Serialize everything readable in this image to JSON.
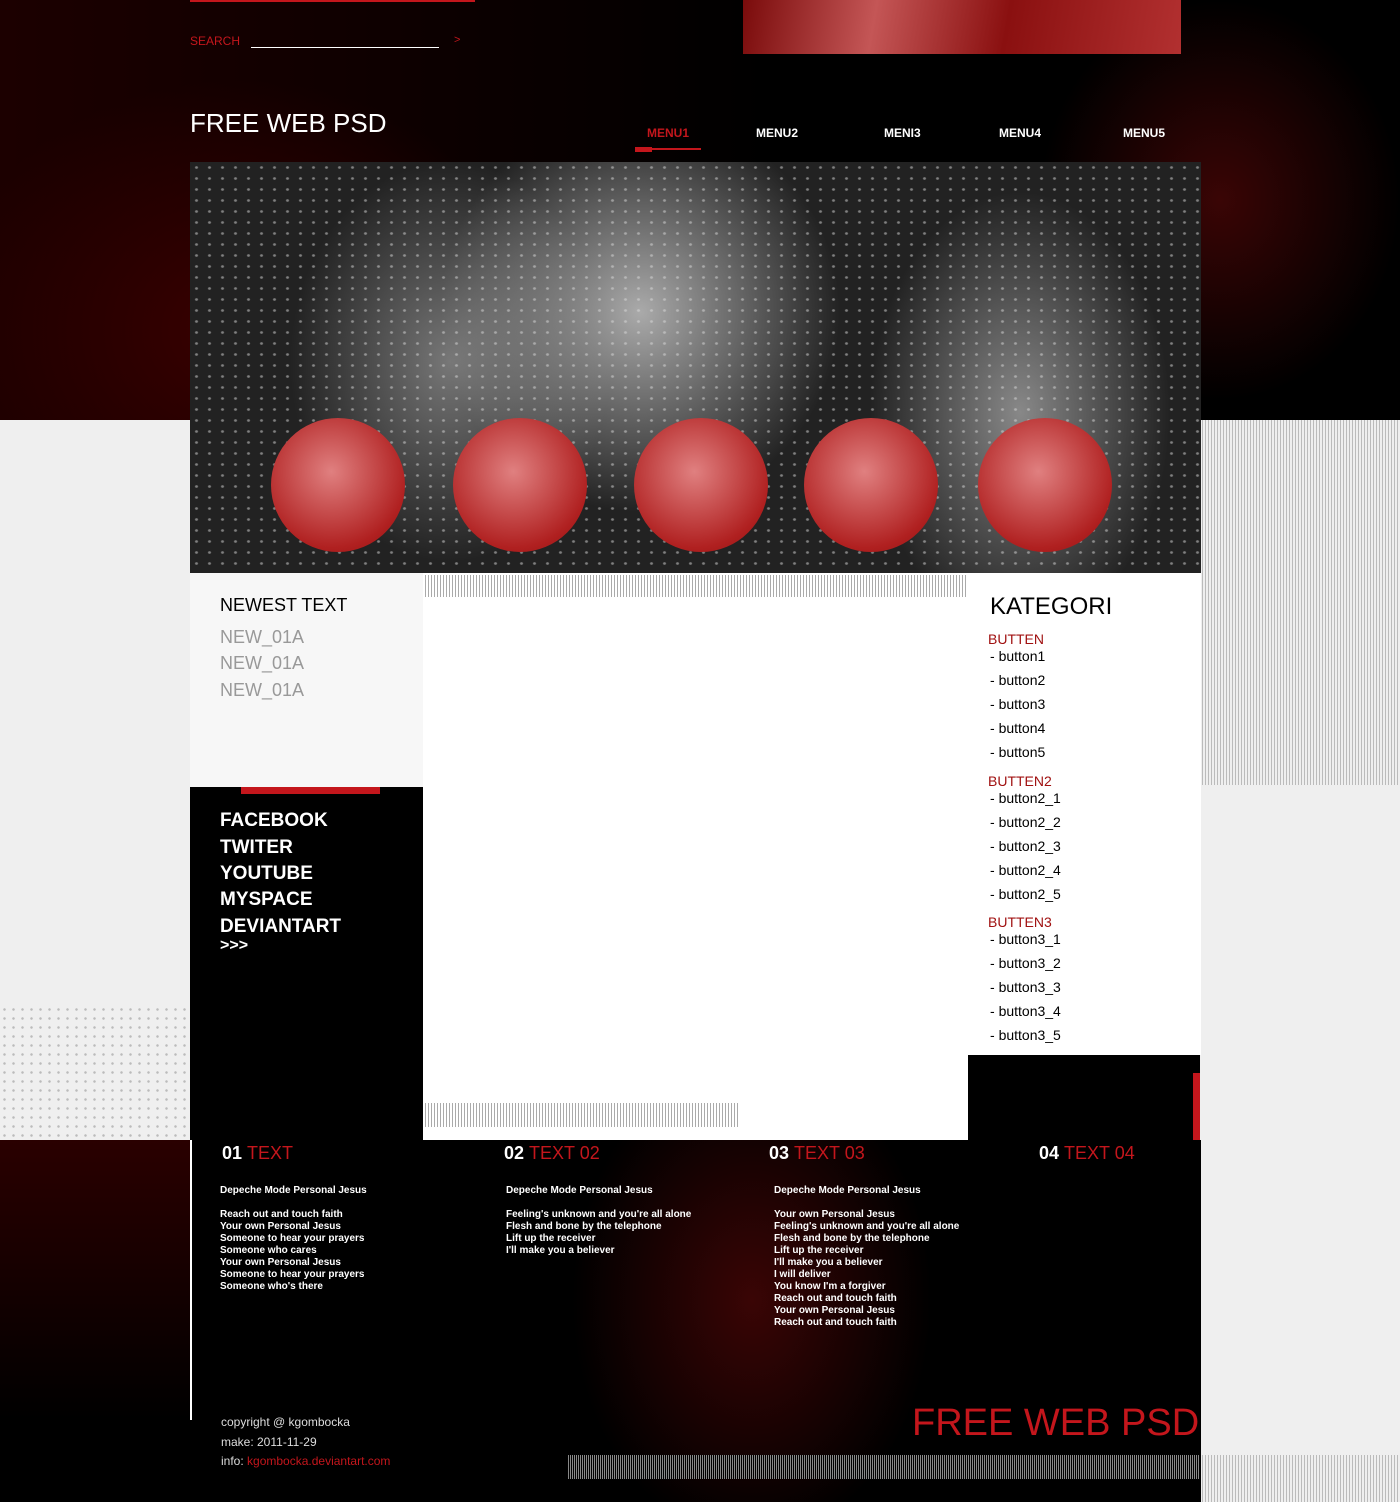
{
  "header": {
    "search_label": "SEARCH",
    "search_value": "",
    "search_go": ">",
    "logo": "FREE WEB PSD",
    "menu": [
      {
        "label": "MENU1",
        "active": true
      },
      {
        "label": "MENU2"
      },
      {
        "label": "MENI3"
      },
      {
        "label": "MENU4"
      },
      {
        "label": "MENU5"
      }
    ]
  },
  "colors": {
    "accent": "#c4161c",
    "background": "#000000",
    "panel": "#efefef"
  },
  "newest": {
    "title": "NEWEST TEXT",
    "items": [
      "NEW_01A",
      "NEW_01A",
      "NEW_01A"
    ]
  },
  "social": {
    "items": [
      "FACEBOOK",
      "TWITER",
      "YOUTUBE",
      "MYSPACE",
      "DEVIANTART",
      ">>>"
    ]
  },
  "kategori": {
    "title": "KATEGORI",
    "groups": [
      {
        "label": "BUTTEN",
        "items": [
          "button1",
          "button2",
          "button3",
          "button4",
          "button5"
        ]
      },
      {
        "label": "BUTTEN2",
        "items": [
          "button2_1",
          "button2_2",
          "button2_3",
          "button2_4",
          "button2_5"
        ]
      },
      {
        "label": "BUTTEN3",
        "items": [
          "button3_1",
          "button3_2",
          "button3_3",
          "button3_4",
          "button3_5"
        ]
      }
    ]
  },
  "columns": [
    {
      "num": "01",
      "title": "TEXT",
      "text": "Depeche Mode Personal Jesus\n\nReach out and touch faith\nYour own Personal Jesus\nSomeone to hear your prayers\nSomeone who cares\nYour own Personal Jesus\nSomeone to hear your prayers\nSomeone who's there"
    },
    {
      "num": "02",
      "title": "TEXT 02",
      "text": "Depeche Mode Personal Jesus\n\nFeeling's unknown and you're all alone\nFlesh and bone by the telephone\nLift up the receiver\nI'll make you a believer"
    },
    {
      "num": "03",
      "title": "TEXT 03",
      "text": "Depeche Mode Personal Jesus\n\nYour own Personal Jesus\nFeeling's unknown and you're all alone\nFlesh and bone by the telephone\nLift up the receiver\nI'll make you a believer\nI will deliver\nYou know I'm a forgiver\nReach out and touch faith\nYour own Personal Jesus\nReach out and touch faith"
    },
    {
      "num": "04",
      "title": "TEXT 04",
      "text": ""
    }
  ],
  "footer": {
    "copyright": "copyright @ kgombocka",
    "make": "make: 2011-11-29",
    "info_label": "info: ",
    "info_link": "kgombocka.deviantart.com",
    "big_logo": "FREE WEB PSD"
  }
}
